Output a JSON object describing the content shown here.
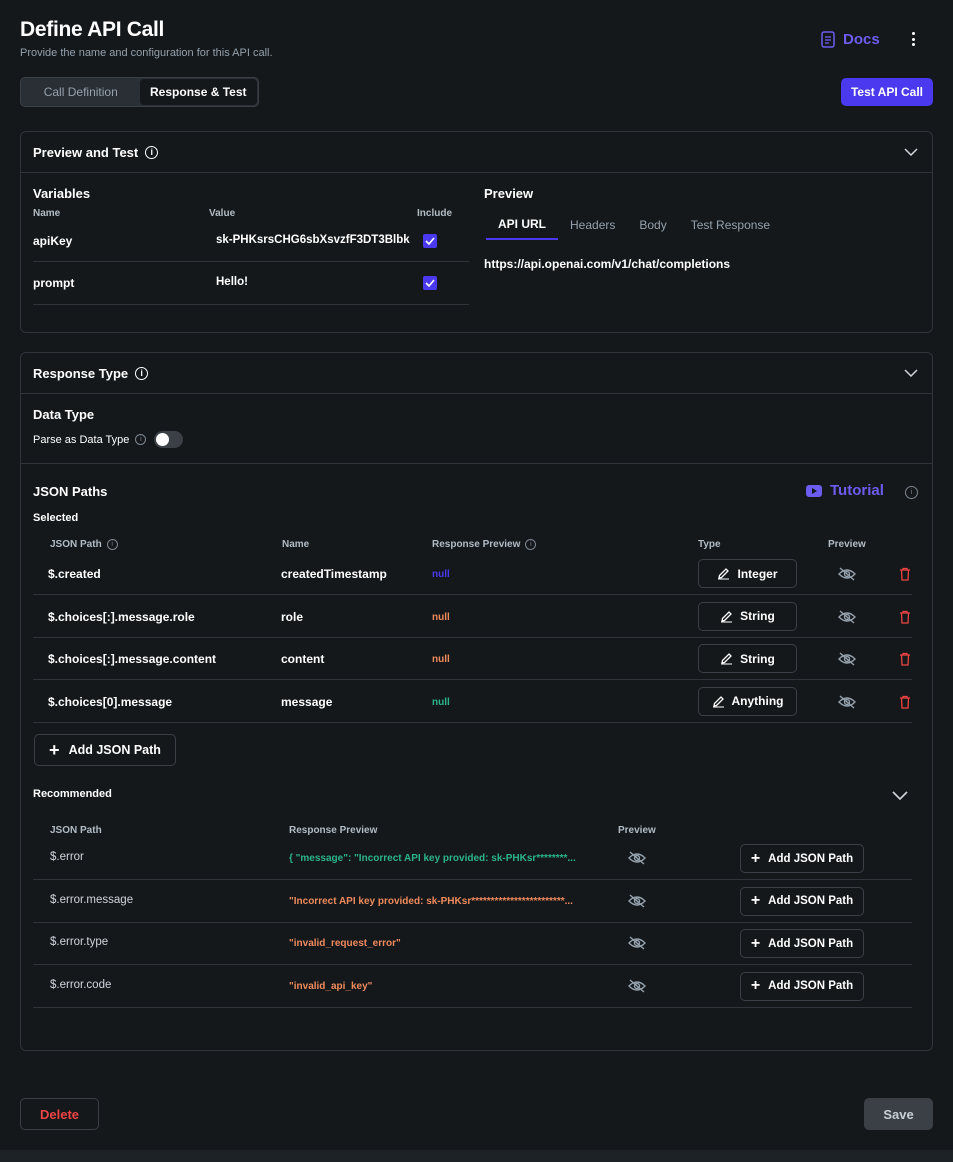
{
  "header": {
    "title": "Define API Call",
    "subtitle": "Provide the name and configuration for this API call.",
    "docs_label": "Docs",
    "tabs": [
      {
        "label": "Call Definition",
        "active": false
      },
      {
        "label": "Response & Test",
        "active": true
      }
    ],
    "test_button": "Test API Call"
  },
  "preview_test": {
    "title": "Preview and Test",
    "variables": {
      "title": "Variables",
      "col_name": "Name",
      "col_value": "Value",
      "col_include": "Include",
      "rows": [
        {
          "name": "apiKey",
          "value": "sk-PHKsrsCHG6sbXsvzfF3DT3Blbk",
          "include": true
        },
        {
          "name": "prompt",
          "value": "Hello!",
          "include": true
        }
      ]
    },
    "preview": {
      "title": "Preview",
      "tabs": [
        "API URL",
        "Headers",
        "Body",
        "Test Response"
      ],
      "active_tab": "API URL",
      "url": "https://api.openai.com/v1/chat/completions"
    }
  },
  "response_type": {
    "title": "Response Type",
    "data_type_title": "Data Type",
    "parse_label": "Parse as Data Type",
    "parse_enabled": false,
    "json_paths_title": "JSON Paths",
    "tutorial_label": "Tutorial",
    "selected_title": "Selected",
    "selected_cols": {
      "path": "JSON Path",
      "name": "Name",
      "preview": "Response Preview",
      "type": "Type",
      "show": "Preview"
    },
    "selected": [
      {
        "path": "$.created",
        "name": "createdTimestamp",
        "preview": "null",
        "preview_color": "#4b39ef",
        "type": "Integer"
      },
      {
        "path": "$.choices[:].message.role",
        "name": "role",
        "preview": "null",
        "preview_color": "#f08b5c",
        "type": "String"
      },
      {
        "path": "$.choices[:].message.content",
        "name": "content",
        "preview": "null",
        "preview_color": "#f08b5c",
        "type": "String"
      },
      {
        "path": "$.choices[0].message",
        "name": "message",
        "preview": "null",
        "preview_color": "#2bb58a",
        "type": "Anything"
      }
    ],
    "add_json_path": "Add JSON Path",
    "recommended_title": "Recommended",
    "recommended_cols": {
      "path": "JSON Path",
      "preview": "Response Preview",
      "show": "Preview"
    },
    "recommended": [
      {
        "path": "$.error",
        "preview": "{  \"message\": \"Incorrect API key provided: sk-PHKsr********...",
        "preview_color": "#2bb58a",
        "button": "Add JSON Path"
      },
      {
        "path": "$.error.message",
        "preview": "\"Incorrect API key provided: sk-PHKsr************************...",
        "preview_color": "#f08b5c",
        "button": "Add JSON Path"
      },
      {
        "path": "$.error.type",
        "preview": "\"invalid_request_error\"",
        "preview_color": "#f08b5c",
        "button": "Add JSON Path"
      },
      {
        "path": "$.error.code",
        "preview": "\"invalid_api_key\"",
        "preview_color": "#f08b5c",
        "button": "Add JSON Path"
      }
    ]
  },
  "footer": {
    "delete_label": "Delete",
    "save_label": "Save"
  },
  "colors": {
    "accent": "#4b39ef",
    "danger": "#ef4444",
    "background": "#14181b"
  }
}
